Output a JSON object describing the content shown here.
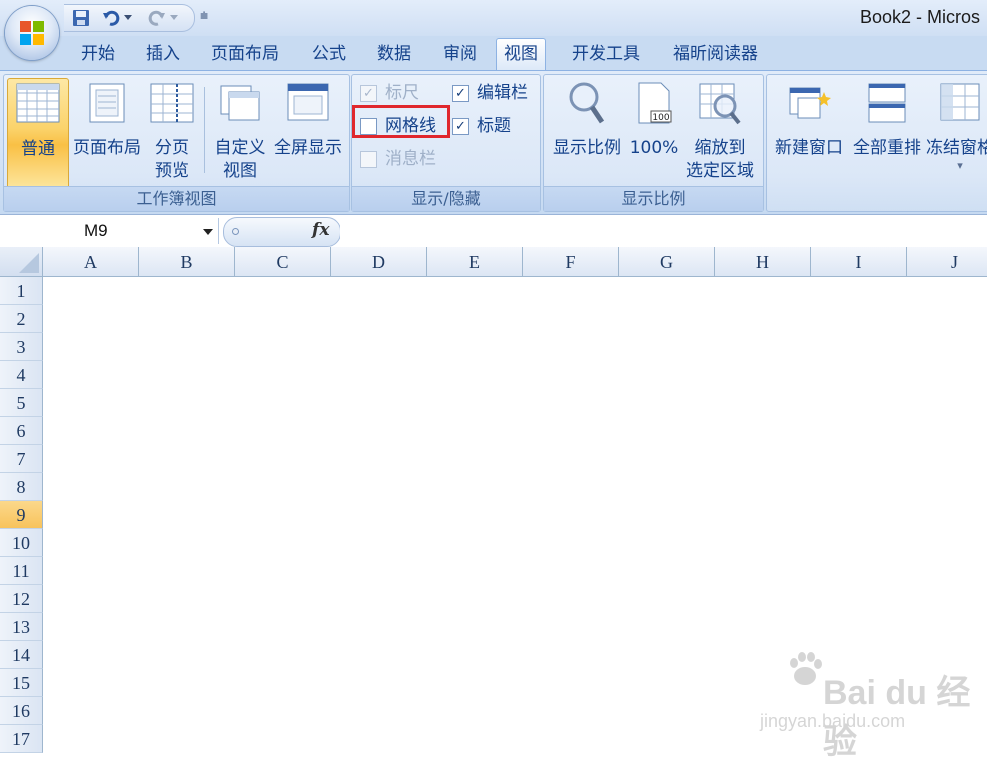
{
  "title_bar": {
    "title": "Book2 - Micros"
  },
  "quick_access": {
    "customize_glyph": "⩧"
  },
  "tabs": [
    {
      "label": "开始"
    },
    {
      "label": "插入"
    },
    {
      "label": "页面布局"
    },
    {
      "label": "公式"
    },
    {
      "label": "数据"
    },
    {
      "label": "审阅"
    },
    {
      "label": "视图",
      "active": true
    },
    {
      "label": "开发工具"
    },
    {
      "label": "福昕阅读器"
    }
  ],
  "ribbon": {
    "workbook_views": {
      "label": "工作簿视图",
      "normal": "普通",
      "page_layout": "页面布局",
      "page_break_1": "分页",
      "page_break_2": "预览",
      "custom_1": "自定义",
      "custom_2": "视图",
      "full_screen": "全屏显示"
    },
    "show_hide": {
      "label": "显示/隐藏",
      "ruler": {
        "label": "标尺",
        "checked": true,
        "enabled": false
      },
      "formula_bar": {
        "label": "编辑栏",
        "checked": true
      },
      "gridlines": {
        "label": "网格线",
        "checked": false
      },
      "headings": {
        "label": "标题",
        "checked": true
      },
      "message_bar": {
        "label": "消息栏",
        "checked": false,
        "enabled": false
      },
      "check_glyph": "✓"
    },
    "zoom": {
      "label": "显示比例",
      "zoom": "显示比例",
      "hundred": "100%",
      "zoom_sel_1": "缩放到",
      "zoom_sel_2": "选定区域"
    },
    "window": {
      "new_window": "新建窗口",
      "arrange_all": "全部重排",
      "freeze": "冻结窗格",
      "freeze_arrow": "▾"
    }
  },
  "formula_bar": {
    "name_box": "M9",
    "fx": "fx"
  },
  "grid": {
    "columns": [
      "A",
      "B",
      "C",
      "D",
      "E",
      "F",
      "G",
      "H",
      "I",
      "J"
    ],
    "rows": [
      "1",
      "2",
      "3",
      "4",
      "5",
      "6",
      "7",
      "8",
      "9",
      "10",
      "11",
      "12",
      "13",
      "14",
      "15",
      "16",
      "17"
    ],
    "active_row": "9"
  },
  "watermark": {
    "brand": "Bai du 经验",
    "url": "jingyan.baidu.com"
  },
  "colors": {
    "accent": "#15428b",
    "highlight_box": "#e0272d",
    "active_row": "#f8c35c"
  }
}
